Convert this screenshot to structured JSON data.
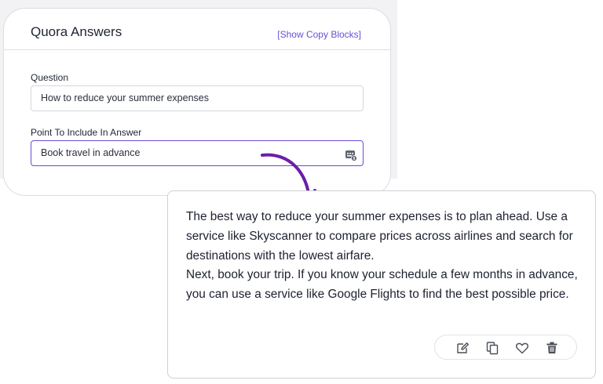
{
  "panel": {
    "title": "Quora Answers",
    "copy_link": "[Show Copy Blocks]"
  },
  "form": {
    "question_label": "Question",
    "question_value": "How to reduce your summer expenses",
    "point_label": "Point To Include In Answer",
    "point_value": "Book travel in advance",
    "point_icon": "keyboard-icon"
  },
  "answer": {
    "paragraph1": "The best way to reduce your summer expenses is to plan ahead. Use a service like Skyscanner to compare prices across airlines and search for destinations with the lowest airfare.",
    "paragraph2": "Next, book your trip. If you know your schedule a few months in advance, you can use a service like Google Flights to find the best possible price."
  },
  "actions": [
    "edit-icon",
    "copy-icon",
    "heart-icon",
    "trash-icon"
  ],
  "colors": {
    "accent": "#6c4bd6",
    "arrow": "#6a1fa8"
  }
}
